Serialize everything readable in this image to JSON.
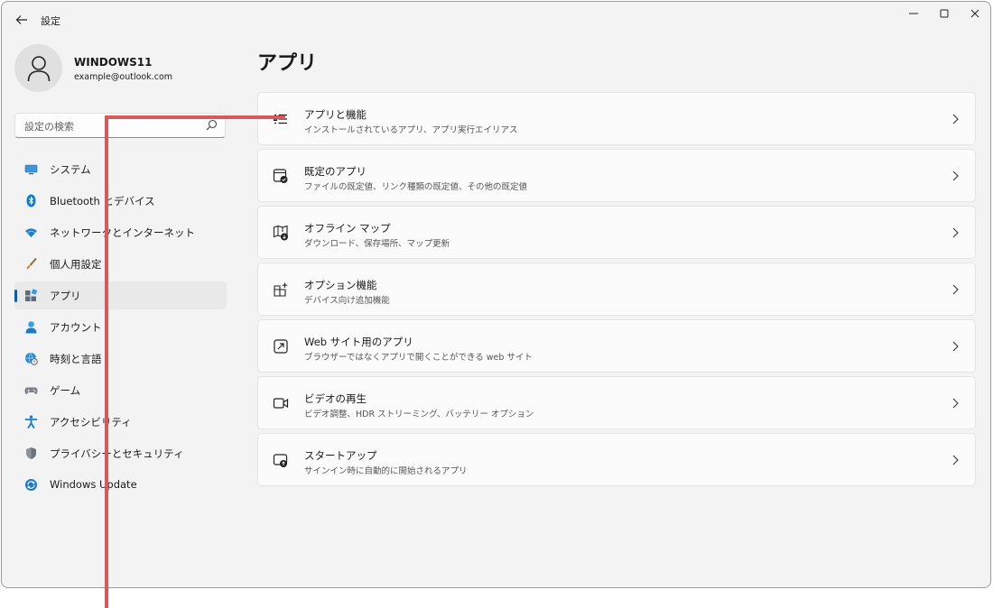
{
  "window": {
    "app_title": "設定",
    "back_icon": "arrow-left-icon",
    "controls": [
      "minimize-icon",
      "maximize-icon",
      "close-icon"
    ]
  },
  "profile": {
    "name": "WINDOWS11",
    "email": "example@outlook.com"
  },
  "search": {
    "placeholder": "設定の検索",
    "value": ""
  },
  "sidebar": {
    "items": [
      {
        "label": "システム",
        "icon": "monitor-icon",
        "active": false
      },
      {
        "label": "Bluetooth とデバイス",
        "icon": "bluetooth-icon",
        "active": false
      },
      {
        "label": "ネットワークとインターネット",
        "icon": "wifi-icon",
        "active": false
      },
      {
        "label": "個人用設定",
        "icon": "brush-icon",
        "active": false
      },
      {
        "label": "アプリ",
        "icon": "apps-icon",
        "active": true
      },
      {
        "label": "アカウント",
        "icon": "person-icon",
        "active": false
      },
      {
        "label": "時刻と言語",
        "icon": "globe-clock-icon",
        "active": false
      },
      {
        "label": "ゲーム",
        "icon": "gamepad-icon",
        "active": false
      },
      {
        "label": "アクセシビリティ",
        "icon": "accessibility-icon",
        "active": false
      },
      {
        "label": "プライバシーとセキュリティ",
        "icon": "shield-icon",
        "active": false
      },
      {
        "label": "Windows Update",
        "icon": "update-icon",
        "active": false
      }
    ]
  },
  "main": {
    "title": "アプリ",
    "cards": [
      {
        "title": "アプリと機能",
        "subtitle": "インストールされているアプリ、アプリ実行エイリアス",
        "icon": "list-icon"
      },
      {
        "title": "既定のアプリ",
        "subtitle": "ファイルの既定値、リンク種類の既定値、その他の既定値",
        "icon": "default-apps-icon"
      },
      {
        "title": "オフライン マップ",
        "subtitle": "ダウンロード、保存場所、マップ更新",
        "icon": "map-download-icon"
      },
      {
        "title": "オプション機能",
        "subtitle": "デバイス向け追加機能",
        "icon": "grid-plus-icon"
      },
      {
        "title": "Web サイト用のアプリ",
        "subtitle": "ブラウザーではなくアプリで開くことができる web サイト",
        "icon": "open-external-icon"
      },
      {
        "title": "ビデオの再生",
        "subtitle": "ビデオ調整、HDR ストリーミング、バッテリー オプション",
        "icon": "video-icon"
      },
      {
        "title": "スタートアップ",
        "subtitle": "サインイン時に自動的に開始されるアプリ",
        "icon": "startup-icon"
      }
    ]
  },
  "colors": {
    "accent": "#005fb8",
    "annotation": "#d9585a",
    "window_bg": "#f3f3f3",
    "card_bg": "#fbfbfb"
  }
}
